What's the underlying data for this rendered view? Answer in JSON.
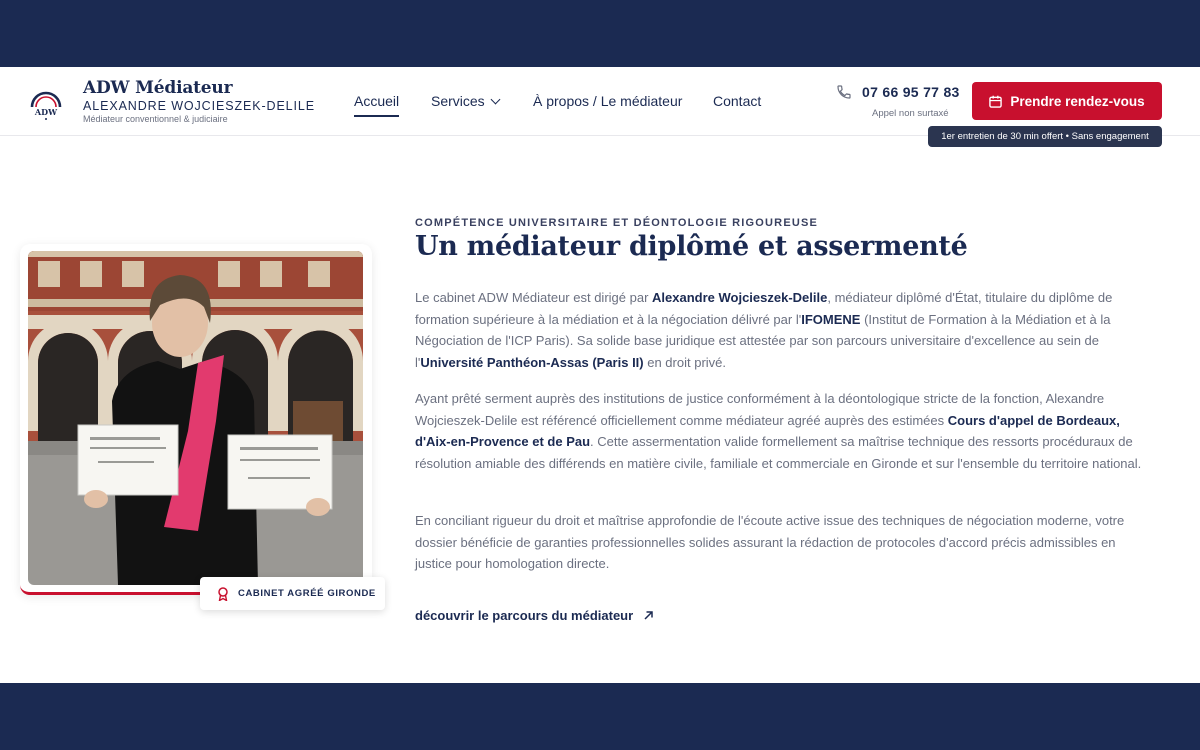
{
  "header": {
    "brand_title": "ADW Médiateur",
    "brand_subtitle": "ALEXANDRE WOJCIESZEK-DELILE",
    "brand_tagline": "Médiateur conventionnel & judiciaire",
    "logo_text": "ADW",
    "nav": {
      "home": "Accueil",
      "services": "Services",
      "about": "À propos / Le médiateur",
      "contact": "Contact"
    },
    "phone": "07 66 95 77 83",
    "phone_note": "Appel non surtaxé",
    "cta_label": "Prendre rendez-vous",
    "cta_tooltip": "1er entretien de 30 min offert • Sans engagement"
  },
  "photo": {
    "badge_label": "CABINET AGRÉÉ GIRONDE"
  },
  "content": {
    "eyebrow": "COMPÉTENCE UNIVERSITAIRE ET DÉONTOLOGIE RIGOUREUSE",
    "headline": "Un médiateur diplômé et assermenté",
    "p1": {
      "a": "Le cabinet ADW Médiateur est dirigé par ",
      "b": "Alexandre Wojcieszek-Delile",
      "c": ", médiateur diplômé d'État, titulaire du diplôme de formation supérieure à la médiation et à la négociation délivré par l'",
      "d": "IFOMENE",
      "e": " (Institut de Formation à la Médiation et à la Négociation de l'ICP Paris). Sa solide base juridique est attestée par son parcours universitaire d'excellence au sein de l'",
      "f": "Université Panthéon-Assas (Paris II)",
      "g": " en droit privé."
    },
    "p2": {
      "a": "Ayant prêté serment auprès des institutions de justice conformément à la déontologique stricte de la fonction, Alexandre Wojcieszek-Delile est référencé officiellement comme médiateur agréé auprès des estimées ",
      "b": "Cours d'appel de Bordeaux, d'Aix-en-Provence et de Pau",
      "c": ". Cette assermentation valide formellement sa maîtrise technique des ressorts procéduraux de résolution amiable des différends en matière civile, familiale et commerciale en Gironde et sur l'ensemble du territoire national."
    },
    "p3": "En conciliant rigueur du droit et maîtrise approfondie de l'écoute active issue des techniques de négociation moderne, votre dossier bénéficie de garanties professionnelles solides assurant la rédaction de protocoles d'accord précis admissibles en justice pour homologation directe.",
    "more_link": "découvrir le parcours du médiateur"
  },
  "colors": {
    "navy": "#1b2a52",
    "accent_red": "#c8102e",
    "muted_text": "#6b7080"
  },
  "icons": [
    "logo-arc-icon",
    "chevron-down-icon",
    "phone-icon",
    "calendar-icon",
    "ribbon-award-icon",
    "arrow-up-right-icon"
  ]
}
